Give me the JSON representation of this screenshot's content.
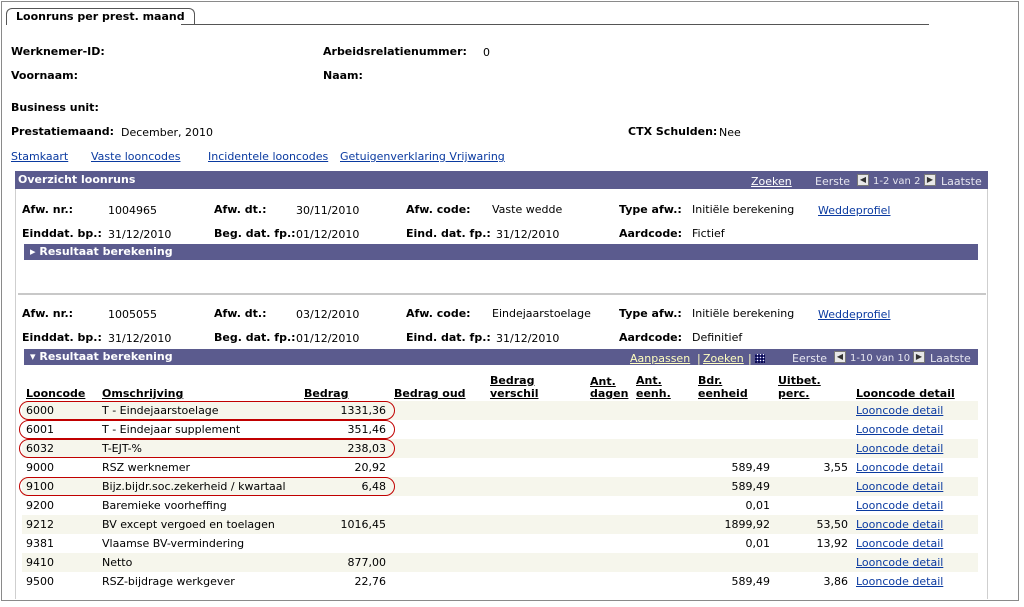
{
  "tab": {
    "label": "Loonruns per prest. maand"
  },
  "header": {
    "werknemer_id_label": "Werknemer-ID:",
    "werknemer_id_value": "",
    "arbeidsrelatie_label": "Arbeidsrelatienummer:",
    "arbeidsrelatie_value": "0",
    "voornaam_label": "Voornaam:",
    "naam_label": "Naam:",
    "business_unit_label": "Business unit:",
    "prestatiemaand_label": "Prestatiemaand:",
    "prestatiemaand_value": "December, 2010",
    "ctx_label": "CTX Schulden:",
    "ctx_value": "Nee"
  },
  "links": [
    "Stamkaart",
    "Vaste looncodes",
    "Incidentele looncodes",
    "Getuigenverklaring Vrijwaring"
  ],
  "grid": {
    "title": "Overzicht loonruns",
    "zoeken": "Zoeken",
    "eerste": "Eerste",
    "range": "1-2 van 2",
    "laatste": "Laatste"
  },
  "labels": {
    "afw_nr": "Afw. nr.:",
    "afw_dt": "Afw. dt.:",
    "afw_code": "Afw. code:",
    "type_afw": "Type afw.:",
    "einddat_bp": "Einddat. bp.:",
    "beg_dat_fp": "Beg. dat. fp.:",
    "eind_dat_fp": "Eind. dat. fp.:",
    "aardcode": "Aardcode:",
    "weddeprofiel": "Weddeprofiel",
    "resultaat": "Resultaat berekening"
  },
  "run1": {
    "afw_nr": "1004965",
    "afw_dt": "30/11/2010",
    "afw_code": "Vaste wedde",
    "type_afw": "Initiële berekening",
    "einddat_bp": "31/12/2010",
    "beg_dat_fp": "01/12/2010",
    "eind_dat_fp": "31/12/2010",
    "aardcode": "Fictief"
  },
  "run2": {
    "afw_nr": "1005055",
    "afw_dt": "03/12/2010",
    "afw_code": "Eindejaarstoelage",
    "type_afw": "Initiële berekening",
    "einddat_bp": "31/12/2010",
    "beg_dat_fp": "01/12/2010",
    "eind_dat_fp": "31/12/2010",
    "aardcode": "Definitief"
  },
  "result_bar": {
    "aanpassen": "Aanpassen",
    "zoeken": "Zoeken",
    "sep": "|",
    "eerste": "Eerste",
    "range": "1-10 van 10",
    "laatste": "Laatste"
  },
  "table": {
    "columns": [
      "Looncode",
      "Omschrijving",
      "Bedrag",
      "Bedrag oud",
      "Bedrag verschil",
      "Ant. dagen",
      "Ant. eenh.",
      "Bdr. eenheid",
      "Uitbet. perc.",
      "Looncode detail"
    ],
    "rows": [
      {
        "code": "6000",
        "omschr": "T - Eindejaarstoelage",
        "bedrag": "1331,36",
        "bdr_eenh": "",
        "perc": "",
        "detail": "Looncode detail"
      },
      {
        "code": "6001",
        "omschr": "T - Eindejaar supplement",
        "bedrag": "351,46",
        "bdr_eenh": "",
        "perc": "",
        "detail": "Looncode detail"
      },
      {
        "code": "6032",
        "omschr": "T-EJT-%",
        "bedrag": "238,03",
        "bdr_eenh": "",
        "perc": "",
        "detail": "Looncode detail"
      },
      {
        "code": "9000",
        "omschr": "RSZ werknemer",
        "bedrag": "20,92",
        "bdr_eenh": "589,49",
        "perc": "3,55",
        "detail": "Looncode detail"
      },
      {
        "code": "9100",
        "omschr": "Bijz.bijdr.soc.zekerheid / kwartaal",
        "bedrag": "6,48",
        "bdr_eenh": "589,49",
        "perc": "",
        "detail": "Looncode detail"
      },
      {
        "code": "9200",
        "omschr": "Baremieke voorheffing",
        "bedrag": "",
        "bdr_eenh": "0,01",
        "perc": "",
        "detail": "Looncode detail"
      },
      {
        "code": "9212",
        "omschr": "BV except vergoed en toelagen",
        "bedrag": "1016,45",
        "bdr_eenh": "1899,92",
        "perc": "53,50",
        "detail": "Looncode detail"
      },
      {
        "code": "9381",
        "omschr": "Vlaamse BV-vermindering",
        "bedrag": "",
        "bdr_eenh": "0,01",
        "perc": "13,92",
        "detail": "Looncode detail"
      },
      {
        "code": "9410",
        "omschr": "Netto",
        "bedrag": "877,00",
        "bdr_eenh": "",
        "perc": "",
        "detail": "Looncode detail"
      },
      {
        "code": "9500",
        "omschr": "RSZ-bijdrage werkgever",
        "bedrag": "22,76",
        "bdr_eenh": "589,49",
        "perc": "3,86",
        "detail": "Looncode detail"
      }
    ]
  },
  "colors": {
    "bar": "#5b5b8e",
    "link": "#0a3aa0",
    "highlight": "#c00000",
    "row_alt": "#f6f6ec"
  }
}
